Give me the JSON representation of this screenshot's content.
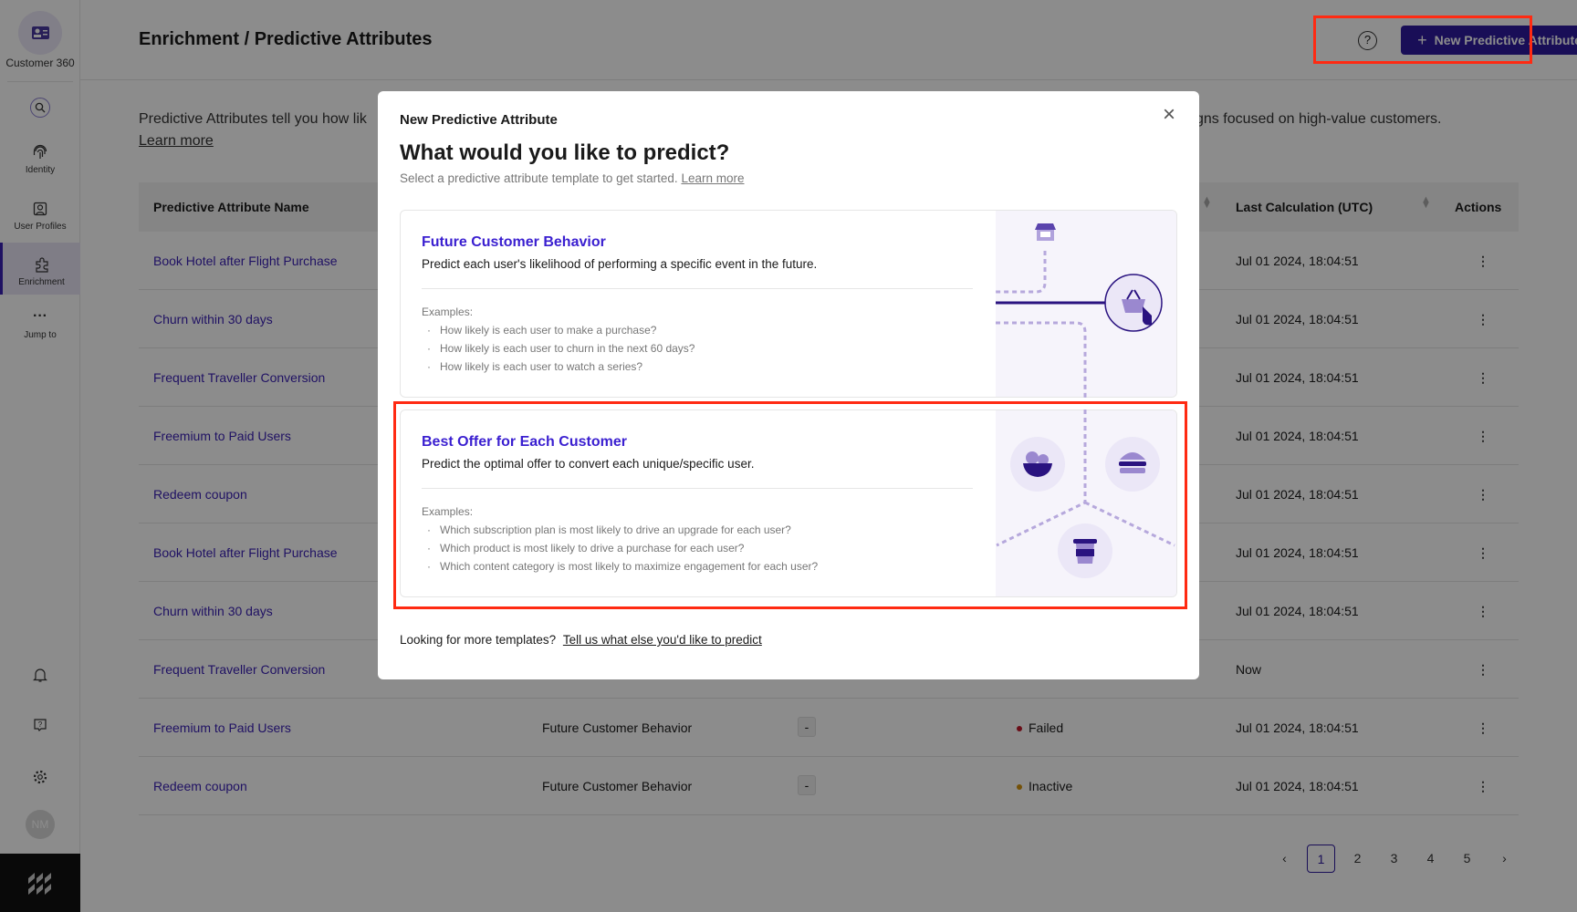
{
  "sidebar": {
    "app_name": "Customer 360",
    "items": [
      {
        "label": "Identity",
        "icon": "fingerprint-icon"
      },
      {
        "label": "User Profiles",
        "icon": "user-profile-icon"
      },
      {
        "label": "Enrichment",
        "icon": "puzzle-icon",
        "active": true
      },
      {
        "label": "Jump to",
        "icon": "more-horizontal-icon"
      }
    ],
    "avatar_initials": "NM"
  },
  "header": {
    "title": "Enrichment / Predictive Attributes",
    "new_button_label": "New Predictive Attribute",
    "help_icon": "?"
  },
  "description": {
    "start": "Predictive Attributes tell you how lik",
    "end": "gns focused on high-value customers.",
    "learn_more": "Learn more"
  },
  "table": {
    "headers": {
      "name": "Predictive Attribute Name",
      "last_calc": "Last Calculation (UTC)",
      "actions": "Actions"
    },
    "rows": [
      {
        "name": "Book Hotel after Flight Purchase",
        "last_calc": "Jul 01 2024, 18:04:51"
      },
      {
        "name": "Churn within 30 days",
        "last_calc": "Jul 01 2024, 18:04:51"
      },
      {
        "name": "Frequent Traveller Conversion",
        "last_calc": "Jul 01 2024, 18:04:51"
      },
      {
        "name": "Freemium to Paid Users",
        "last_calc": "Jul 01 2024, 18:04:51"
      },
      {
        "name": "Redeem coupon",
        "last_calc": "Jul 01 2024, 18:04:51"
      },
      {
        "name": "Book Hotel after Flight Purchase",
        "last_calc": "Jul 01 2024, 18:04:51"
      },
      {
        "name": "Churn within 30 days",
        "last_calc": "Jul 01 2024, 18:04:51"
      },
      {
        "name": "Frequent Traveller Conversion",
        "last_calc": "Now"
      },
      {
        "name": "Freemium to Paid Users",
        "type": "Future Customer Behavior",
        "chip": "-",
        "status": "Failed",
        "status_color": "#c0192b",
        "last_calc": "Jul 01 2024, 18:04:51"
      },
      {
        "name": "Redeem coupon",
        "type": "Future Customer Behavior",
        "chip": "-",
        "status": "Inactive",
        "status_color": "#d4940f",
        "last_calc": "Jul 01 2024, 18:04:51"
      }
    ]
  },
  "pagination": {
    "pages": [
      "1",
      "2",
      "3",
      "4",
      "5"
    ],
    "current": "1"
  },
  "modal": {
    "title": "New Predictive Attribute",
    "heading": "What would you like to predict?",
    "subtitle": "Select a predictive attribute template to get started.",
    "learn_more": "Learn more",
    "cards": [
      {
        "title": "Future Customer Behavior",
        "description": "Predict each user's likelihood of performing a specific event in the future.",
        "examples_label": "Examples:",
        "examples": [
          "How likely is each user to make a purchase?",
          "How likely is each user to churn in the next 60 days?",
          "How likely is each user to watch a series?"
        ]
      },
      {
        "title": "Best Offer for Each Customer",
        "description": "Predict the optimal offer to convert each unique/specific user.",
        "examples_label": "Examples:",
        "examples": [
          "Which subscription plan is most likely to drive an upgrade for each user?",
          "Which product is most likely to drive a purchase for each user?",
          "Which content category is most likely to maximize engagement for each user?"
        ]
      }
    ],
    "footer_text": "Looking for more templates?",
    "footer_link": "Tell us what else you'd like to predict"
  },
  "colors": {
    "accent": "#2e1a9e",
    "link": "#3a1fd0",
    "highlight": "#ff2a12"
  }
}
